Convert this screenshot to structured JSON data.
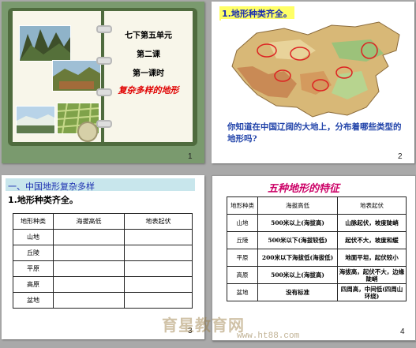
{
  "slides": [
    {
      "number": "1",
      "title_lines": [
        "七下第五单元",
        "第二课",
        "第一课时"
      ],
      "subtitle": "复杂多样的地形"
    },
    {
      "number": "2",
      "heading": "1.地形种类齐全。",
      "question": "你知道在中国辽阔的大地上，分布着哪些类型的地形吗?"
    },
    {
      "number": "3",
      "section_title": "一、中国地形复杂多样",
      "heading": "1.地形种类齐全。",
      "table": {
        "headers": [
          "地形种类",
          "海拔高低",
          "地表起伏"
        ],
        "rows": [
          "山地",
          "丘陵",
          "平原",
          "高原",
          "盆地"
        ]
      }
    },
    {
      "number": "4",
      "title": "五种地形的特征",
      "table": {
        "headers": [
          "地形种类",
          "海拔高低",
          "地表起伏"
        ],
        "rows": [
          [
            "山地",
            "500米以上(海拔高)",
            "山脉起伏，坡度陡峭"
          ],
          [
            "丘陵",
            "500米以下(海拔较低)",
            "起伏不大，坡度和缓"
          ],
          [
            "平原",
            "200米以下海拔低(海拔低)",
            "地面平坦，起伏较小"
          ],
          [
            "高原",
            "500米以上(海拔高)",
            "海拔高，起伏不大，边缘陡峭"
          ],
          [
            "盆地",
            "没有标准",
            "四周高，中间低(四周山环绕)"
          ]
        ]
      }
    }
  ],
  "watermark": {
    "text": "育星教育网",
    "url": "www.ht88.com"
  }
}
